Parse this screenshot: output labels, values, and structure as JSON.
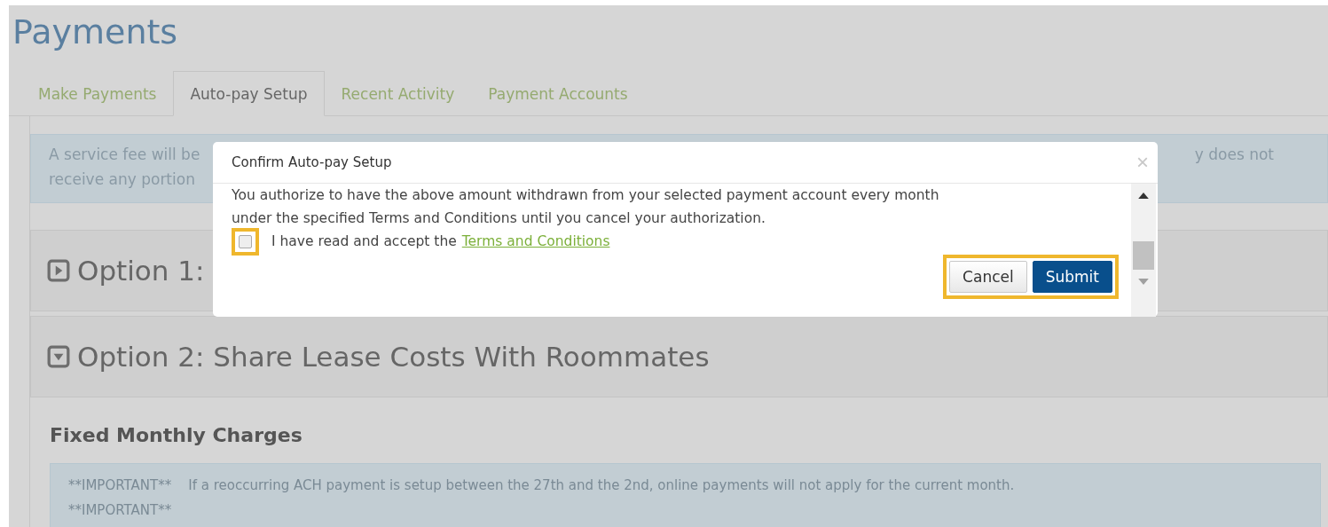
{
  "page": {
    "title": "Payments"
  },
  "tabs": [
    {
      "label": "Make Payments",
      "selected": false
    },
    {
      "label": "Auto-pay Setup",
      "selected": true
    },
    {
      "label": "Recent Activity",
      "selected": false
    },
    {
      "label": "Payment Accounts",
      "selected": false
    }
  ],
  "notice": {
    "left_lines": [
      "A service fee will be",
      "receive any portion"
    ],
    "right_lines": [
      "y does not"
    ]
  },
  "options": [
    {
      "title": "Option 1:",
      "expanded": false
    },
    {
      "title": "Option 2: Share Lease Costs With Roommates",
      "expanded": true
    }
  ],
  "section": {
    "heading": "Fixed Monthly Charges",
    "important_lines": [
      "**IMPORTANT**    If a reoccurring ACH payment is setup between the 27th and the 2nd, online payments will not apply for the current month.",
      "**IMPORTANT**"
    ]
  },
  "dialog": {
    "title": "Confirm Auto-pay Setup",
    "close": "×",
    "lines": [
      "You authorize to have the above amount withdrawn from your selected payment account every month",
      "under the specified Terms and Conditions until you cancel your authorization."
    ],
    "accept": {
      "checked": false,
      "highlighted": true,
      "label": "I have read and accept the",
      "link": "Terms and Conditions"
    },
    "buttons_highlighted": true,
    "buttons": [
      {
        "label": "Cancel",
        "kind": "secondary"
      },
      {
        "label": "Submit",
        "kind": "primary"
      }
    ]
  }
}
